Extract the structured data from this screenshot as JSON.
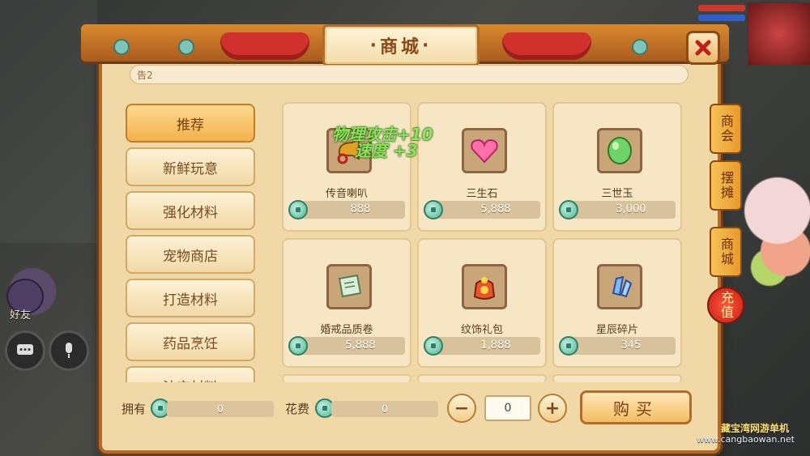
{
  "window": {
    "title": "商城",
    "notice": "告2"
  },
  "hud": {
    "friends_label": "好友"
  },
  "categories": [
    {
      "label": "推荐",
      "active": true
    },
    {
      "label": "新鲜玩意",
      "active": false
    },
    {
      "label": "强化材料",
      "active": false
    },
    {
      "label": "宠物商店",
      "active": false
    },
    {
      "label": "打造材料",
      "active": false
    },
    {
      "label": "药品烹饪",
      "active": false
    },
    {
      "label": "法宝材料",
      "active": false
    }
  ],
  "items": [
    {
      "name": "传音喇叭",
      "price": "888",
      "icon": "horn-icon"
    },
    {
      "name": "三生石",
      "price": "5,888",
      "icon": "heart-stone-icon"
    },
    {
      "name": "三世玉",
      "price": "3,000",
      "icon": "green-jade-icon"
    },
    {
      "name": "婚戒品质卷",
      "price": "5,888",
      "icon": "scroll-icon"
    },
    {
      "name": "纹饰礼包",
      "price": "1,888",
      "icon": "gift-bag-icon"
    },
    {
      "name": "星辰碎片",
      "price": "345",
      "icon": "crystal-icon"
    }
  ],
  "floating_text": {
    "line1": "物理攻击+10",
    "line2": "速度 +3"
  },
  "side_tabs": [
    "商会",
    "摆摊",
    "商城",
    "充值"
  ],
  "bottom": {
    "owned_label": "拥有",
    "owned_value": "0",
    "cost_label": "花费",
    "cost_value": "0",
    "quantity": "0",
    "minus": "−",
    "plus": "+",
    "buy_label": "购买"
  },
  "watermark": {
    "brand": "藏宝湾网游单机",
    "url": "www.cangbaowan.net"
  },
  "colors": {
    "frame_border": "#b36b2a",
    "panel_bg": "#f0d9a6",
    "active_tab": "#f3b14d",
    "coin": "#4fb593",
    "float_text": "#8ee05c"
  }
}
